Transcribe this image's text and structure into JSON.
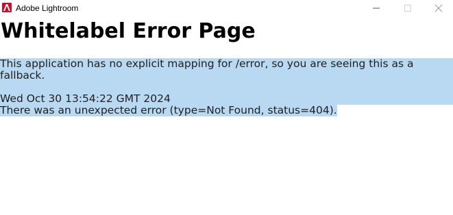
{
  "window": {
    "title": "Adobe Lightroom",
    "app_icon": "adobe-icon",
    "controls": {
      "minimize_icon": "minimize-icon",
      "maximize_icon": "maximize-icon",
      "close_icon": "close-icon"
    }
  },
  "page": {
    "heading": "Whitelabel Error Page",
    "message_line_1": "This application has no explicit mapping for /error, so you are seeing this as a",
    "message_line_2": "fallback.",
    "timestamp": "Wed Oct 30 13:54:22 GMT 2024",
    "error_detail": "There was an unexpected error (type=Not Found, status=404)."
  },
  "colors": {
    "selection": "#b8d9f1",
    "adobe_red": "#c8102e"
  }
}
